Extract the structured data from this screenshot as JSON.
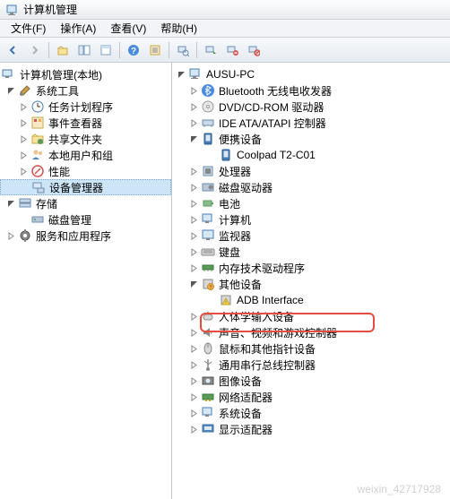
{
  "window": {
    "title": "计算机管理"
  },
  "menu": {
    "file": "文件(F)",
    "action": "操作(A)",
    "view": "查看(V)",
    "help": "帮助(H)"
  },
  "left_tree": {
    "root": "计算机管理(本地)",
    "system_tools": "系统工具",
    "task_scheduler": "任务计划程序",
    "event_viewer": "事件查看器",
    "shared_folders": "共享文件夹",
    "local_users": "本地用户和组",
    "performance": "性能",
    "device_manager": "设备管理器",
    "storage": "存储",
    "disk_management": "磁盘管理",
    "services_apps": "服务和应用程序"
  },
  "right_tree": {
    "root": "AUSU-PC",
    "bluetooth": "Bluetooth 无线电收发器",
    "dvd": "DVD/CD-ROM 驱动器",
    "ide": "IDE ATA/ATAPI 控制器",
    "portable": "便携设备",
    "coolpad": "Coolpad T2-C01",
    "processors": "处理器",
    "disk_drives": "磁盘驱动器",
    "batteries": "电池",
    "computer": "计算机",
    "monitors": "监视器",
    "keyboards": "键盘",
    "memory_tech": "内存技术驱动程序",
    "other_devices": "其他设备",
    "adb": "ADB Interface",
    "hid": "人体学输入设备",
    "sound": "声音、视频和游戏控制器",
    "mice": "鼠标和其他指针设备",
    "usb": "通用串行总线控制器",
    "imaging": "图像设备",
    "network": "网络适配器",
    "system_devices": "系统设备",
    "display": "显示适配器"
  },
  "watermark": "weixin_42717928"
}
